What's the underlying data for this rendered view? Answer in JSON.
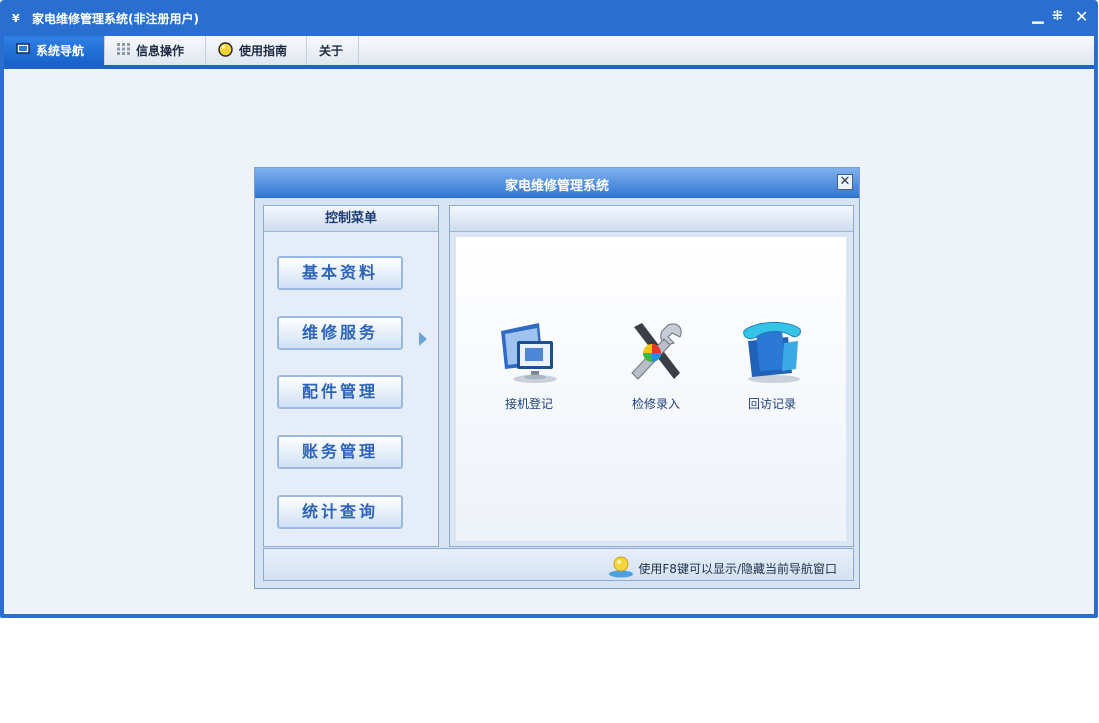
{
  "window": {
    "title": "家电维修管理系统(非注册用户)",
    "logo_glyph": "¥",
    "controls": [
      "minimize-icon",
      "restore-icon",
      "close-icon"
    ]
  },
  "tabs": [
    {
      "label": "系统导航",
      "icon": "monitor-icon",
      "active": true
    },
    {
      "label": "信息操作",
      "icon": "grid-icon",
      "active": false
    },
    {
      "label": "使用指南",
      "icon": "bulb-icon",
      "active": false
    },
    {
      "label": "关于",
      "icon": "",
      "active": false
    }
  ],
  "dialog": {
    "title": "家电维修管理系统",
    "menu_header": "控制菜单",
    "menu_items": [
      "基本资料",
      "维修服务",
      "配件管理",
      "账务管理",
      "统计查询"
    ],
    "selected_item": "维修服务",
    "features": [
      {
        "label": "接机登记",
        "icon": "computer-monitor-icon"
      },
      {
        "label": "检修录入",
        "icon": "repair-tools-icon"
      },
      {
        "label": "回访记录",
        "icon": "phone-folder-icon"
      }
    ],
    "tip": "使用F8键可以显示/隐藏当前导航窗口"
  },
  "colors": {
    "titlebar": "#2a6fd0",
    "accent": "#1d63c7",
    "content_bg": "#edf3f8",
    "menu_text": "#2d63b8"
  }
}
